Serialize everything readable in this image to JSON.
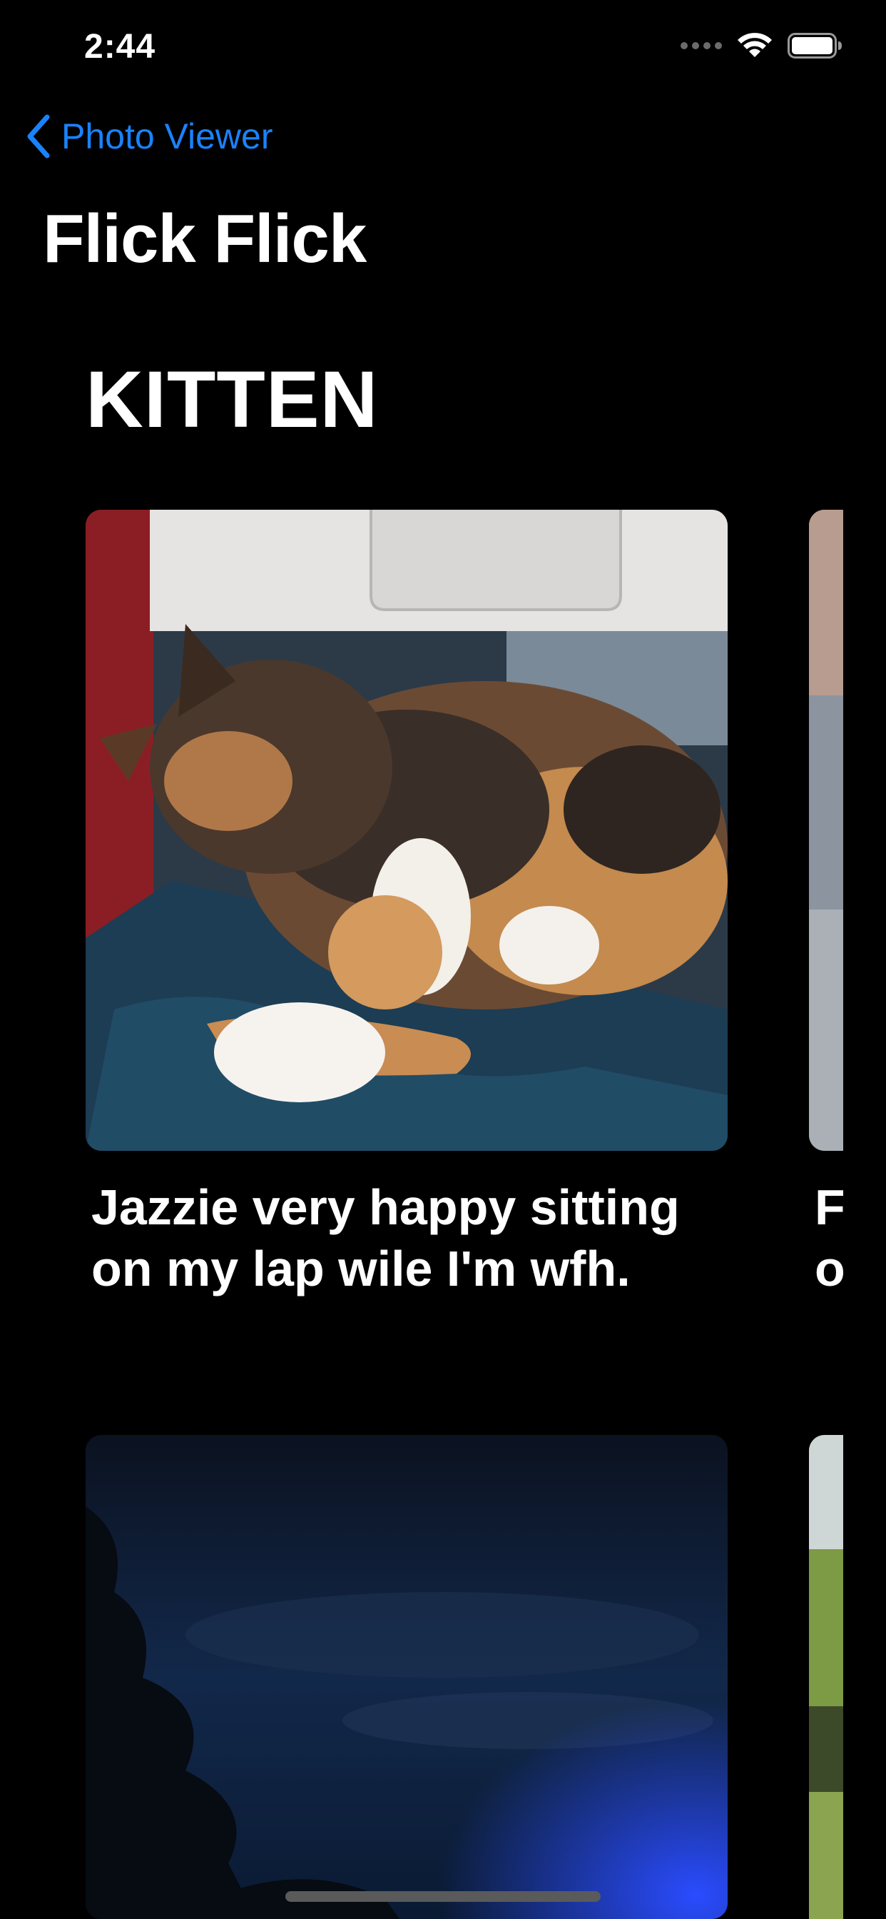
{
  "status_bar": {
    "time": "2:44",
    "icons": [
      "cellular-signal-icon",
      "wifi-icon",
      "battery-icon"
    ]
  },
  "navigation": {
    "back_label": "Photo Viewer",
    "title": "Flick Flick"
  },
  "section": {
    "title": "KITTEN"
  },
  "photos": [
    {
      "caption_line_1": "Jazzie very happy sitting",
      "caption_line_2": "on my lap wile I'm wfh.",
      "image": "calico-kitten-photo"
    },
    {
      "caption_line_1": "F",
      "caption_line_2": "o",
      "image": "partial-photo"
    },
    {
      "image": "night-sky-trees-photo"
    },
    {
      "image": "green-landscape-photo"
    }
  ],
  "colors": {
    "background": "#000000",
    "accent": "#1a82fb",
    "text": "#ffffff"
  }
}
